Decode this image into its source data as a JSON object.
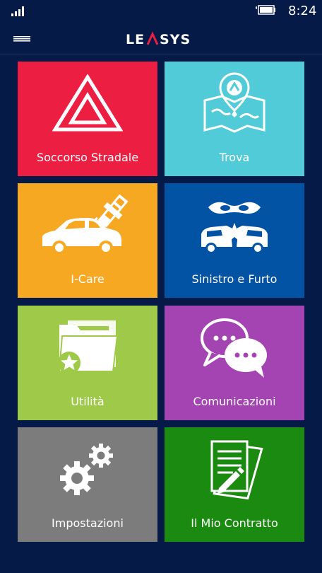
{
  "status": {
    "time": "8:24"
  },
  "header": {
    "brand": "LEASYS"
  },
  "tiles": [
    {
      "label": "Soccorso Stradale",
      "color": "#ec1f42",
      "icon": "warning-triangle-icon"
    },
    {
      "label": "Trova",
      "color": "#52cbd8",
      "icon": "map-pin-icon"
    },
    {
      "label": "I-Care",
      "color": "#f6a823",
      "icon": "car-satellite-icon"
    },
    {
      "label": "Sinistro e Furto",
      "color": "#0353a5",
      "icon": "crash-thief-icon"
    },
    {
      "label": "Utilità",
      "color": "#9fc948",
      "icon": "folder-star-icon"
    },
    {
      "label": "Comunicazioni",
      "color": "#a443b2",
      "icon": "chat-bubbles-icon"
    },
    {
      "label": "Impostazioni",
      "color": "#7c7c7c",
      "icon": "gears-icon"
    },
    {
      "label": "Il Mio Contratto",
      "color": "#1b8a10",
      "icon": "contract-document-icon"
    }
  ]
}
